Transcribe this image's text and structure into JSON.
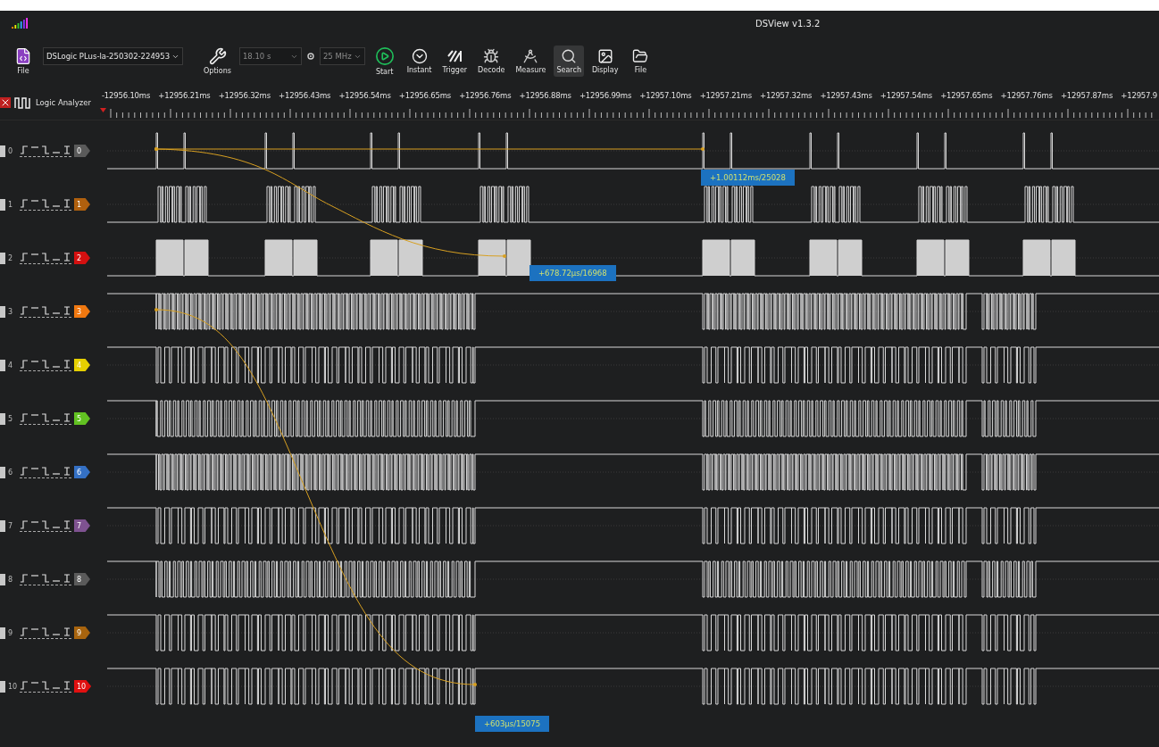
{
  "window": {
    "title": "DSView v1.3.2"
  },
  "toolbar": {
    "file_label": "File",
    "device": "DSLogic PLus-la-250302-224953",
    "options_label": "Options",
    "duration": {
      "value": "18.10 s",
      "disabled": true
    },
    "rate": {
      "value": "25 MHz",
      "disabled": true
    },
    "actions": [
      {
        "kind": "start",
        "label": "Start",
        "selected": false
      },
      {
        "kind": "instant",
        "label": "Instant",
        "selected": false
      },
      {
        "kind": "trigger",
        "label": "Trigger",
        "selected": false
      },
      {
        "kind": "decode",
        "label": "Decode",
        "selected": false
      },
      {
        "kind": "measure",
        "label": "Measure",
        "selected": false
      },
      {
        "kind": "search",
        "label": "Search",
        "selected": true
      },
      {
        "kind": "display",
        "label": "Display",
        "selected": false
      },
      {
        "kind": "file",
        "label": "File",
        "selected": false
      }
    ]
  },
  "ruler": {
    "mode": "Logic Analyzer",
    "ticks": [
      "-12956.10ms",
      "+12956.21ms",
      "+12956.32ms",
      "+12956.43ms",
      "+12956.54ms",
      "+12956.65ms",
      "+12956.76ms",
      "+12956.88ms",
      "+12956.99ms",
      "+12957.10ms",
      "+12957.21ms",
      "+12957.32ms",
      "+12957.43ms",
      "+12957.54ms",
      "+12957.65ms",
      "+12957.76ms",
      "+12957.87ms",
      "+12957.9"
    ]
  },
  "channels": [
    {
      "index": "0",
      "tag": "0",
      "color": "#5a5a5a",
      "kind": "pulse"
    },
    {
      "index": "1",
      "tag": "1",
      "color": "#b0600e",
      "kind": "burst"
    },
    {
      "index": "2",
      "tag": "2",
      "color": "#d41010",
      "kind": "block"
    },
    {
      "index": "3",
      "tag": "3",
      "color": "#f07810",
      "kind": "dense"
    },
    {
      "index": "4",
      "tag": "4",
      "color": "#e6d000",
      "kind": "clock"
    },
    {
      "index": "5",
      "tag": "5",
      "color": "#62c222",
      "kind": "dense"
    },
    {
      "index": "6",
      "tag": "6",
      "color": "#3470c4",
      "kind": "dense"
    },
    {
      "index": "7",
      "tag": "7",
      "color": "#7e5290",
      "kind": "clock"
    },
    {
      "index": "8",
      "tag": "8",
      "color": "#5a5a5a",
      "kind": "dense"
    },
    {
      "index": "9",
      "tag": "9",
      "color": "#a8640e",
      "kind": "clock"
    },
    {
      "index": "10",
      "tag": "10",
      "color": "#e01010",
      "kind": "clock"
    }
  ],
  "measurements": [
    {
      "label": "+1.00112ms/25028"
    },
    {
      "label": "+678.72µs/16968"
    },
    {
      "label": "+603µs/15075"
    }
  ]
}
